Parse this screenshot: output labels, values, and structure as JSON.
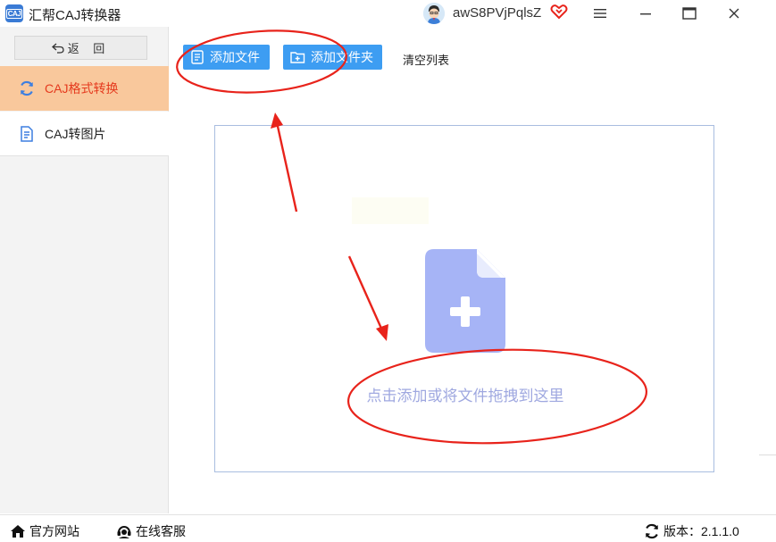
{
  "window": {
    "title": "汇帮CAJ转换器",
    "logo_text": "CAJ",
    "username": "awS8PVjPqlsZ",
    "icons": [
      "app-logo-icon",
      "avatar",
      "vip-heart-icon",
      "menu-icon",
      "minimize-icon",
      "maximize-icon",
      "close-icon"
    ]
  },
  "sidebar": {
    "back_label": "返 回",
    "items": [
      {
        "label": "CAJ格式转换",
        "icon": "refresh-icon",
        "active": true
      },
      {
        "label": "CAJ转图片",
        "icon": "document-icon",
        "active": false
      }
    ]
  },
  "toolbar": {
    "add_file_label": "添加文件",
    "add_folder_label": "添加文件夹",
    "clear_label": "清空列表"
  },
  "dropzone": {
    "hint": "点击添加或将文件拖拽到这里",
    "icon": "add-file-icon"
  },
  "statusbar": {
    "website_label": "官方网站",
    "support_label": "在线客服",
    "version_label": "版本：2.1.1.0"
  },
  "colors": {
    "accent": "#3d9df2",
    "active_bg": "#f9c89c",
    "active_text": "#e53a1e",
    "annotation": "#e8231b",
    "drop_icon": "#a6b4f6"
  }
}
